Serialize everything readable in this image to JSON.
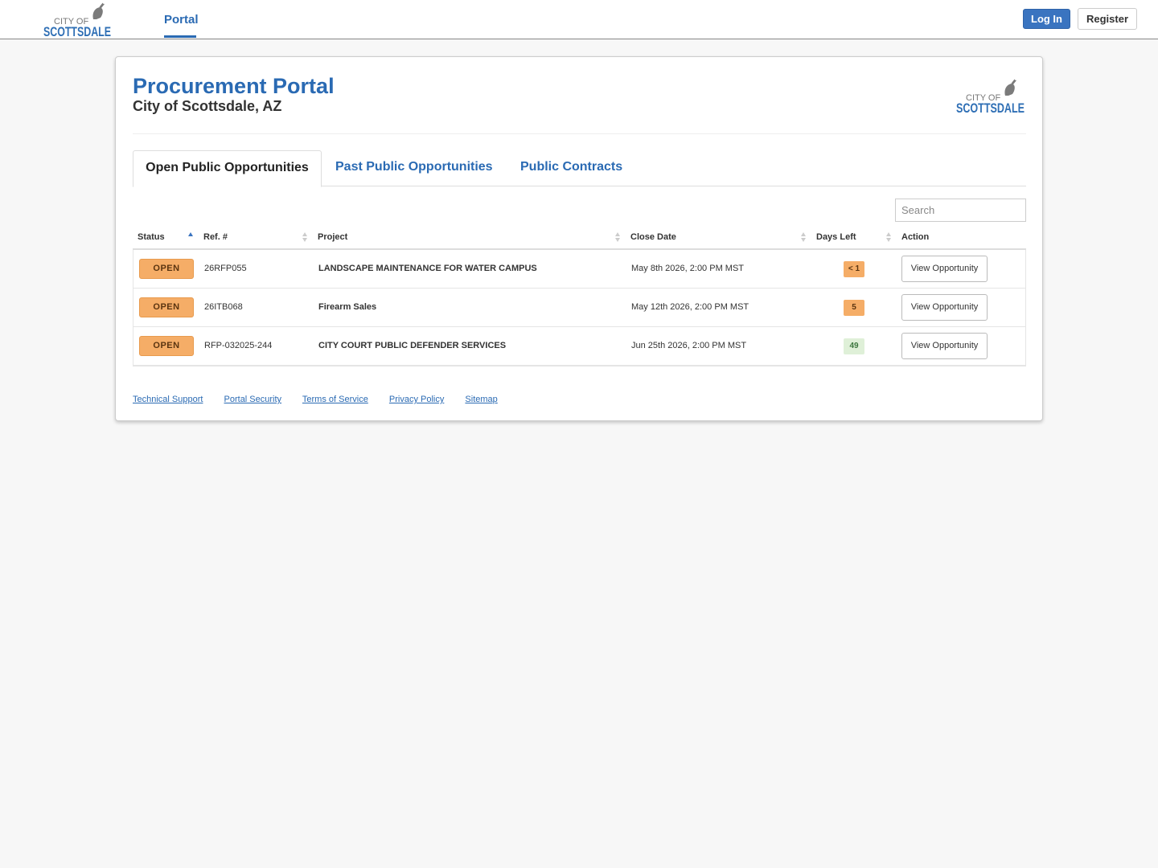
{
  "nav": {
    "logo_line1": "CITY OF",
    "logo_line2": "SCOTTSDALE",
    "portal_tab": "Portal",
    "login_label": "Log In",
    "register_label": "Register"
  },
  "header": {
    "title": "Procurement Portal",
    "subtitle": "City of Scottsdale, AZ",
    "logo_line1": "CITY OF",
    "logo_line2": "SCOTTSDALE"
  },
  "tabs": [
    {
      "label": "Open Public Opportunities",
      "active": true
    },
    {
      "label": "Past Public Opportunities",
      "active": false
    },
    {
      "label": "Public Contracts",
      "active": false
    }
  ],
  "search": {
    "placeholder": "Search",
    "value": ""
  },
  "table": {
    "columns": [
      "Status",
      "Ref. #",
      "Project",
      "Close Date",
      "Days Left",
      "Action"
    ],
    "rows": [
      {
        "status": "OPEN",
        "ref": "26RFP055",
        "project": "LANDSCAPE MAINTENANCE FOR WATER CAMPUS",
        "close_date": "May 8th 2026, 2:00 PM MST",
        "days_left": "< 1",
        "action": "View Opportunity"
      },
      {
        "status": "OPEN",
        "ref": "26ITB068",
        "project": "Firearm Sales",
        "close_date": "May 12th 2026, 2:00 PM MST",
        "days_left": "5",
        "action": "View Opportunity"
      },
      {
        "status": "OPEN",
        "ref": "RFP-032025-244",
        "project": "CITY COURT PUBLIC DEFENDER SERVICES",
        "close_date": "Jun 25th 2026, 2:00 PM MST",
        "days_left": "49",
        "action": "View Opportunity"
      }
    ]
  },
  "footer": {
    "links": [
      "Technical Support",
      "Portal Security",
      "Terms of Service",
      "Privacy Policy",
      "Sitemap"
    ]
  },
  "colors": {
    "brand_blue": "#2a6ab3",
    "status_orange": "#f5ad67",
    "days_ok_green": "#dff0d8"
  }
}
